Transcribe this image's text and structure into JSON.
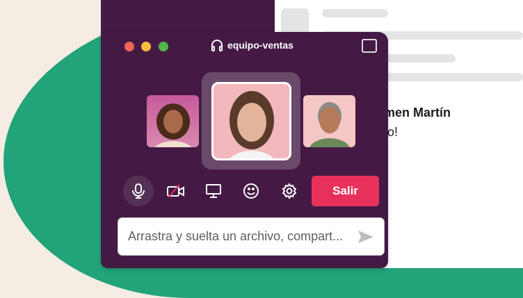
{
  "window": {
    "title": "equipo-ventas",
    "leave_label": "Salir",
    "message_placeholder": "Arrastra y suelta un archivo, compart..."
  },
  "document": {
    "sender": "armen Martín",
    "message": "o!"
  },
  "colors": {
    "window": "#441a44",
    "leave": "#e8315a",
    "green": "#22a37a"
  }
}
